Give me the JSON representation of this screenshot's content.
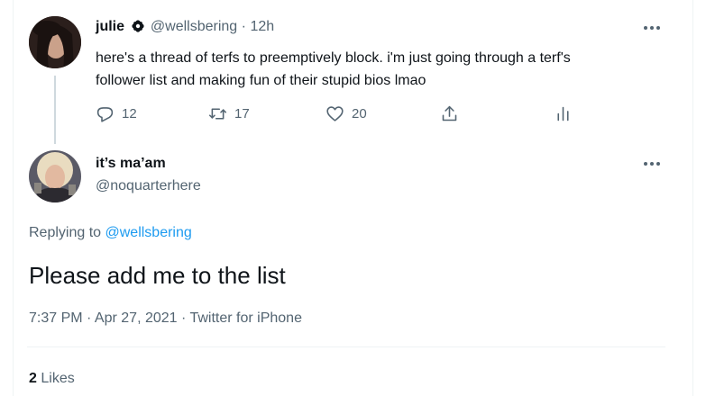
{
  "parent_tweet": {
    "display_name": "julie",
    "name_badge_icon": "flower-icon",
    "handle": "@wellsbering",
    "separator": "·",
    "time": "12h",
    "text_line1": "here's a thread of terfs to preemptively block. i'm just going through a terf's",
    "text_line2": "follower list and making fun of their stupid bios lmao",
    "actions": {
      "reply_count": "12",
      "retweet_count": "17",
      "like_count": "20"
    }
  },
  "reply_tweet": {
    "display_name": "it’s ma’am",
    "handle": "@noquarterhere",
    "replying_prefix": "Replying to",
    "replying_to": "@wellsbering",
    "text": "Please add me to the list",
    "timestamp": "7:37 PM · Apr 27, 2021 · Twitter for iPhone",
    "likes_count": "2",
    "likes_label": "Likes"
  },
  "colors": {
    "link": "#1d9bf0",
    "muted": "#536471",
    "text": "#0f1419",
    "divider": "#eff3f4"
  }
}
